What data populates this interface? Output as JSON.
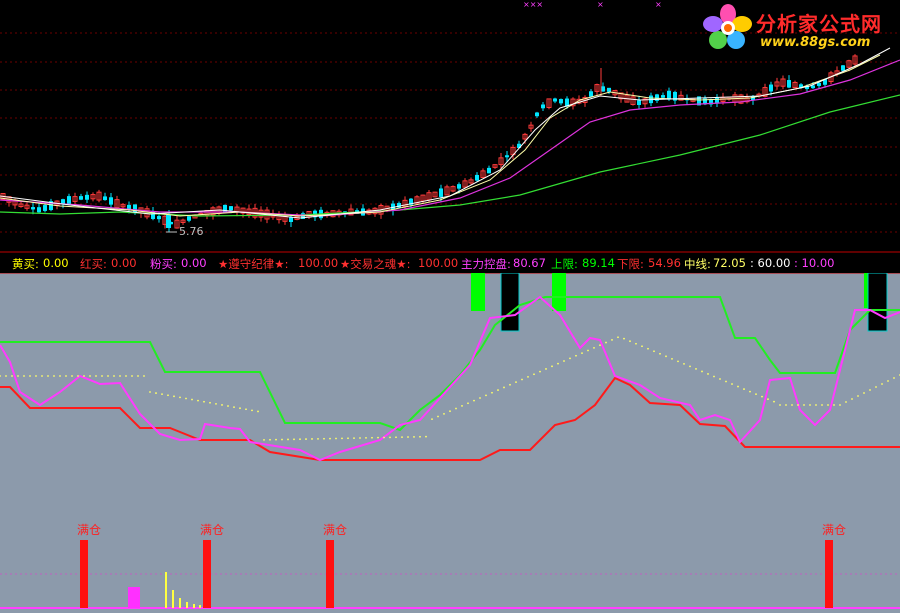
{
  "watermark": {
    "title": "分析家公式网",
    "url": "www.88gs.com"
  },
  "price_chart": {
    "low_label": "5.76",
    "marker_glyph": "×××",
    "marker_glyph2": "×",
    "marker_glyph3": "×"
  },
  "info_bar": {
    "huang": {
      "label": "黄买:",
      "value": "0.00",
      "color": "#ffff00"
    },
    "hong": {
      "label": "红买:",
      "value": "0.00",
      "color": "#ff3030"
    },
    "fen": {
      "label": "粉买:",
      "value": "0.00",
      "color": "#ff40ff"
    },
    "jilv": {
      "label": "★遵守纪律★:",
      "value": "100.00",
      "color": "#ff3030"
    },
    "zhihun": {
      "label": "★交易之魂★:",
      "value": "100.00",
      "color": "#ff3030"
    },
    "zhuli": {
      "label": "主力控盘:",
      "value": "80.67",
      "color": "#ff40ff"
    },
    "shang": {
      "label": "上限:",
      "value": "89.14",
      "color": "#00ff00"
    },
    "xia": {
      "label": "下限:",
      "value": "54.96",
      "color": "#ff3030"
    },
    "zhong": {
      "label": "中线:",
      "value": "72.05",
      "color": "#ffff00"
    },
    "sixty": {
      "value": ": 60.00",
      "color": "#ffffff"
    },
    "ten": {
      "value": ": 10.00",
      "color": "#ff40ff"
    }
  },
  "signals": {
    "full_label": "满仓"
  },
  "colors": {
    "up": "#ff3b3b",
    "down": "#00e6ff",
    "indicator_bg": "#8c9aab",
    "upper_line": "#22ee22",
    "lower_line": "#ff1a1a",
    "main_line": "#ff3bff",
    "mid_line": "#ffff66"
  }
}
